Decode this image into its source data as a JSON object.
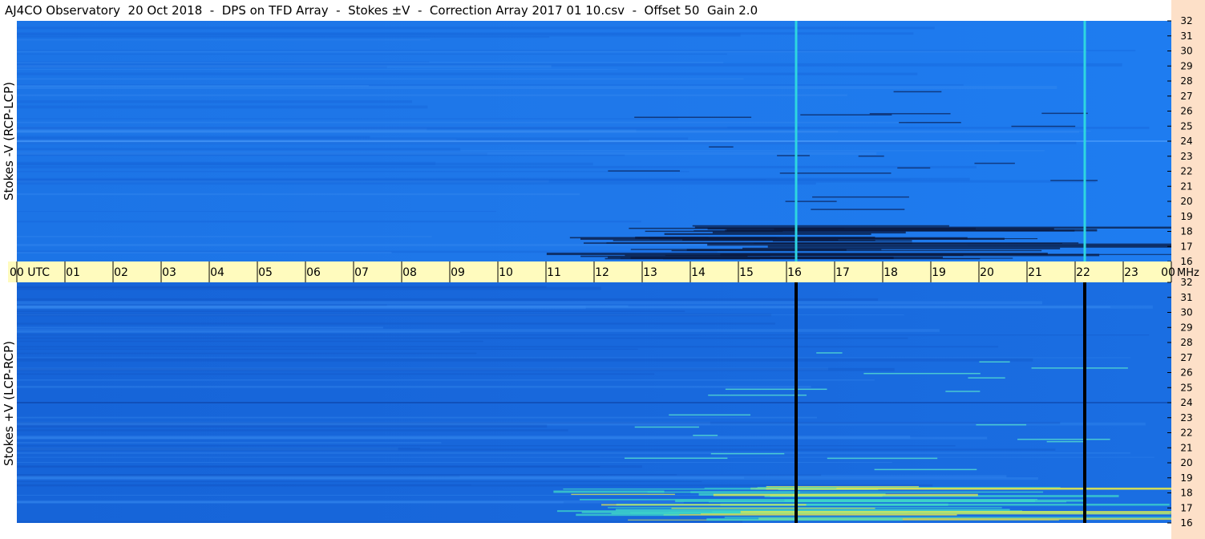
{
  "title": "AJ4CO Observatory  20 Oct 2018  -  DPS on TFD Array  -  Stokes ±V  -  Correction Array 2017 01 10.csv  -  Offset 50  Gain 2.0",
  "colors": {
    "plot_bg": "#1a72e8",
    "time_axis_bg": "#fffbbe",
    "right_strip": "#fde0c8",
    "black_marker": "#000000",
    "cyan_marker": "#2ed6e0"
  },
  "chart_data": [
    {
      "type": "heatmap",
      "ylabel": "Stokes -V (RCP-LCP)",
      "xlim": [
        0,
        24
      ],
      "ylim": [
        16,
        32
      ],
      "y_ticks": [
        "16",
        "17",
        "18",
        "19",
        "20",
        "21",
        "22",
        "23",
        "24",
        "25",
        "26",
        "27",
        "28",
        "29",
        "30",
        "31",
        "32"
      ],
      "vertical_markers_hours": [
        16.2,
        22.2
      ],
      "marker_color": "cyan"
    },
    {
      "type": "heatmap",
      "ylabel": "Stokes +V (LCP-RCP)",
      "xlim": [
        0,
        24
      ],
      "ylim": [
        16,
        32
      ],
      "y_ticks": [
        "16",
        "17",
        "18",
        "19",
        "20",
        "21",
        "22",
        "23",
        "24",
        "25",
        "26",
        "27",
        "28",
        "29",
        "30",
        "31",
        "32"
      ],
      "vertical_markers_hours": [
        16.2,
        22.2
      ],
      "marker_color": "black"
    }
  ],
  "time_axis": {
    "ticks": [
      "00 UTC",
      "01",
      "02",
      "03",
      "04",
      "05",
      "06",
      "07",
      "08",
      "09",
      "10",
      "11",
      "12",
      "13",
      "14",
      "15",
      "16",
      "17",
      "18",
      "19",
      "20",
      "21",
      "22",
      "23",
      "00"
    ],
    "unit": "MHz"
  }
}
